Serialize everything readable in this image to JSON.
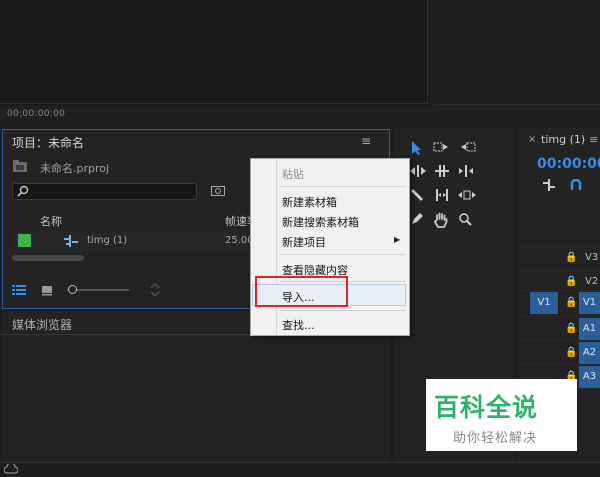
{
  "monitor": {
    "timecode": "00:00:00:00"
  },
  "project": {
    "title": "项目：未命名",
    "menu_glyph": "≡",
    "file_name": "未命名.prproj",
    "columns": {
      "name": "名称",
      "rate": "帧速率"
    },
    "rows": [
      {
        "name": "timg (1)",
        "rate": "25.00",
        "label_color": "#3fb34f"
      }
    ]
  },
  "media_browser": {
    "tab": "媒体浏览器"
  },
  "timeline": {
    "tab": "timg (1)",
    "close": "×",
    "menu_glyph": "≡",
    "timecode": "00:00:00",
    "tracks": [
      {
        "label": "V3",
        "source": ""
      },
      {
        "label": "V2",
        "source": ""
      },
      {
        "label": "V1",
        "source": "V1"
      },
      {
        "label": "A1",
        "source": ""
      },
      {
        "label": "A2",
        "source": ""
      },
      {
        "label": "A3",
        "source": ""
      }
    ]
  },
  "context_menu": {
    "items": [
      {
        "label": "粘贴",
        "disabled": true
      },
      {
        "label": "新建素材箱"
      },
      {
        "label": "新建搜索素材箱"
      },
      {
        "label": "新建项目",
        "submenu": true
      },
      {
        "label": "查看隐藏内容"
      },
      {
        "label": "导入...",
        "highlighted": true
      },
      {
        "label": "查找..."
      }
    ],
    "submenu_arrow": "▶"
  },
  "watermark": {
    "title": "百科全说",
    "subtitle": "助你轻松解决"
  },
  "colors": {
    "accent": "#3b8ae6",
    "highlight_border": "#e0262b",
    "watermark_green": "#2fb36a"
  }
}
